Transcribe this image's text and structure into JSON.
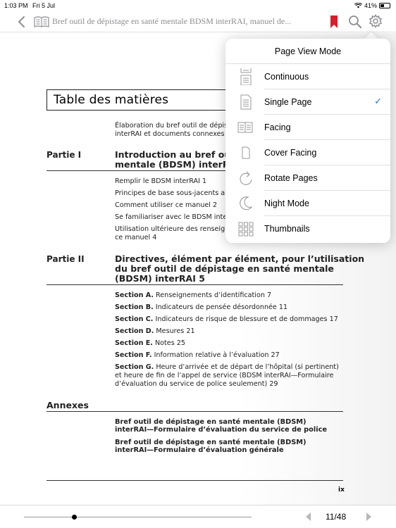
{
  "status": {
    "time": "1:03 PM",
    "date": "Fri 5 Jul",
    "battery": "41%"
  },
  "toolbar": {
    "title": "Bref outil de dépistage en santé mentale BDSM interRAI, manuel de..."
  },
  "doc": {
    "toc_title": "Table des matières",
    "intro_lines": [
      "Élaboration du bref outil de dépis",
      "interRAI et documents connexes"
    ],
    "part1": {
      "label": "Partie I",
      "heading": [
        "Introduction au bref outi",
        "mentale (BDSM) interRAI"
      ],
      "items": [
        "Remplir le BDSM interRAI   1",
        "Principes de base sous-jacents au",
        "Comment utiliser ce manuel   2",
        "Se familiariser avec le BDSM inte",
        "Utilisation ultérieure des renseig",
        "ce manuel   4"
      ]
    },
    "part2": {
      "label": "Partie II",
      "heading": [
        "Directives, élément par élément, pour l’utilisation",
        "du bref outil de dépistage en santé mentale",
        "(BDSM) interRAI   5"
      ],
      "sections": [
        {
          "prefix": "Section A.",
          "text": " Renseignements d’identification   7"
        },
        {
          "prefix": "Section B.",
          "text": " Indicateurs de pensée désordonnée   11"
        },
        {
          "prefix": "Section C.",
          "text": " Indicateurs de risque de blessure et de dommages   17"
        },
        {
          "prefix": "Section D.",
          "text": " Mesures   21"
        },
        {
          "prefix": "Section E.",
          "text": " Notes   25"
        },
        {
          "prefix": "Section F.",
          "text": " Information relative à l’évaluation   27"
        },
        {
          "prefix": "Section G.",
          "text": " Heure d’arrivée et de départ de l’hôpital (si pertinent)"
        }
      ],
      "section_g_cont": [
        "et heure de fin de l’appel de service (BDSM interRAI—Formulaire",
        "d’évaluation du service de police seulement)   29"
      ]
    },
    "annexes": {
      "label": "Annexes",
      "items": [
        [
          "Bref outil de dépistage en santé mentale (BDSM)",
          "interRAI—Formulaire d’évaluation du service de police"
        ],
        [
          "Bref outil de dépistage en santé mentale (BDSM)",
          "interRAI—Formulaire d’évaluation générale"
        ]
      ]
    },
    "page_number": "ix"
  },
  "popover": {
    "title": "Page View Mode",
    "items": [
      {
        "label": "Continuous",
        "icon": "continuous-icon",
        "checked": false
      },
      {
        "label": "Single Page",
        "icon": "single-page-icon",
        "checked": true
      },
      {
        "label": "Facing",
        "icon": "facing-icon",
        "checked": false
      },
      {
        "label": "Cover Facing",
        "icon": "cover-facing-icon",
        "checked": false
      },
      {
        "label": "Rotate Pages",
        "icon": "rotate-pages-icon",
        "checked": false
      },
      {
        "label": "Night Mode",
        "icon": "night-mode-icon",
        "checked": false
      },
      {
        "label": "Thumbnails",
        "icon": "thumbnails-icon",
        "checked": false
      }
    ],
    "check_glyph": "✓"
  },
  "bottom": {
    "page_indicator": "11/48",
    "slider_progress": 0.22
  },
  "colors": {
    "accent": "#1a73e8",
    "bookmark": "#d81e2c",
    "icon_gray": "#8e8e93"
  }
}
